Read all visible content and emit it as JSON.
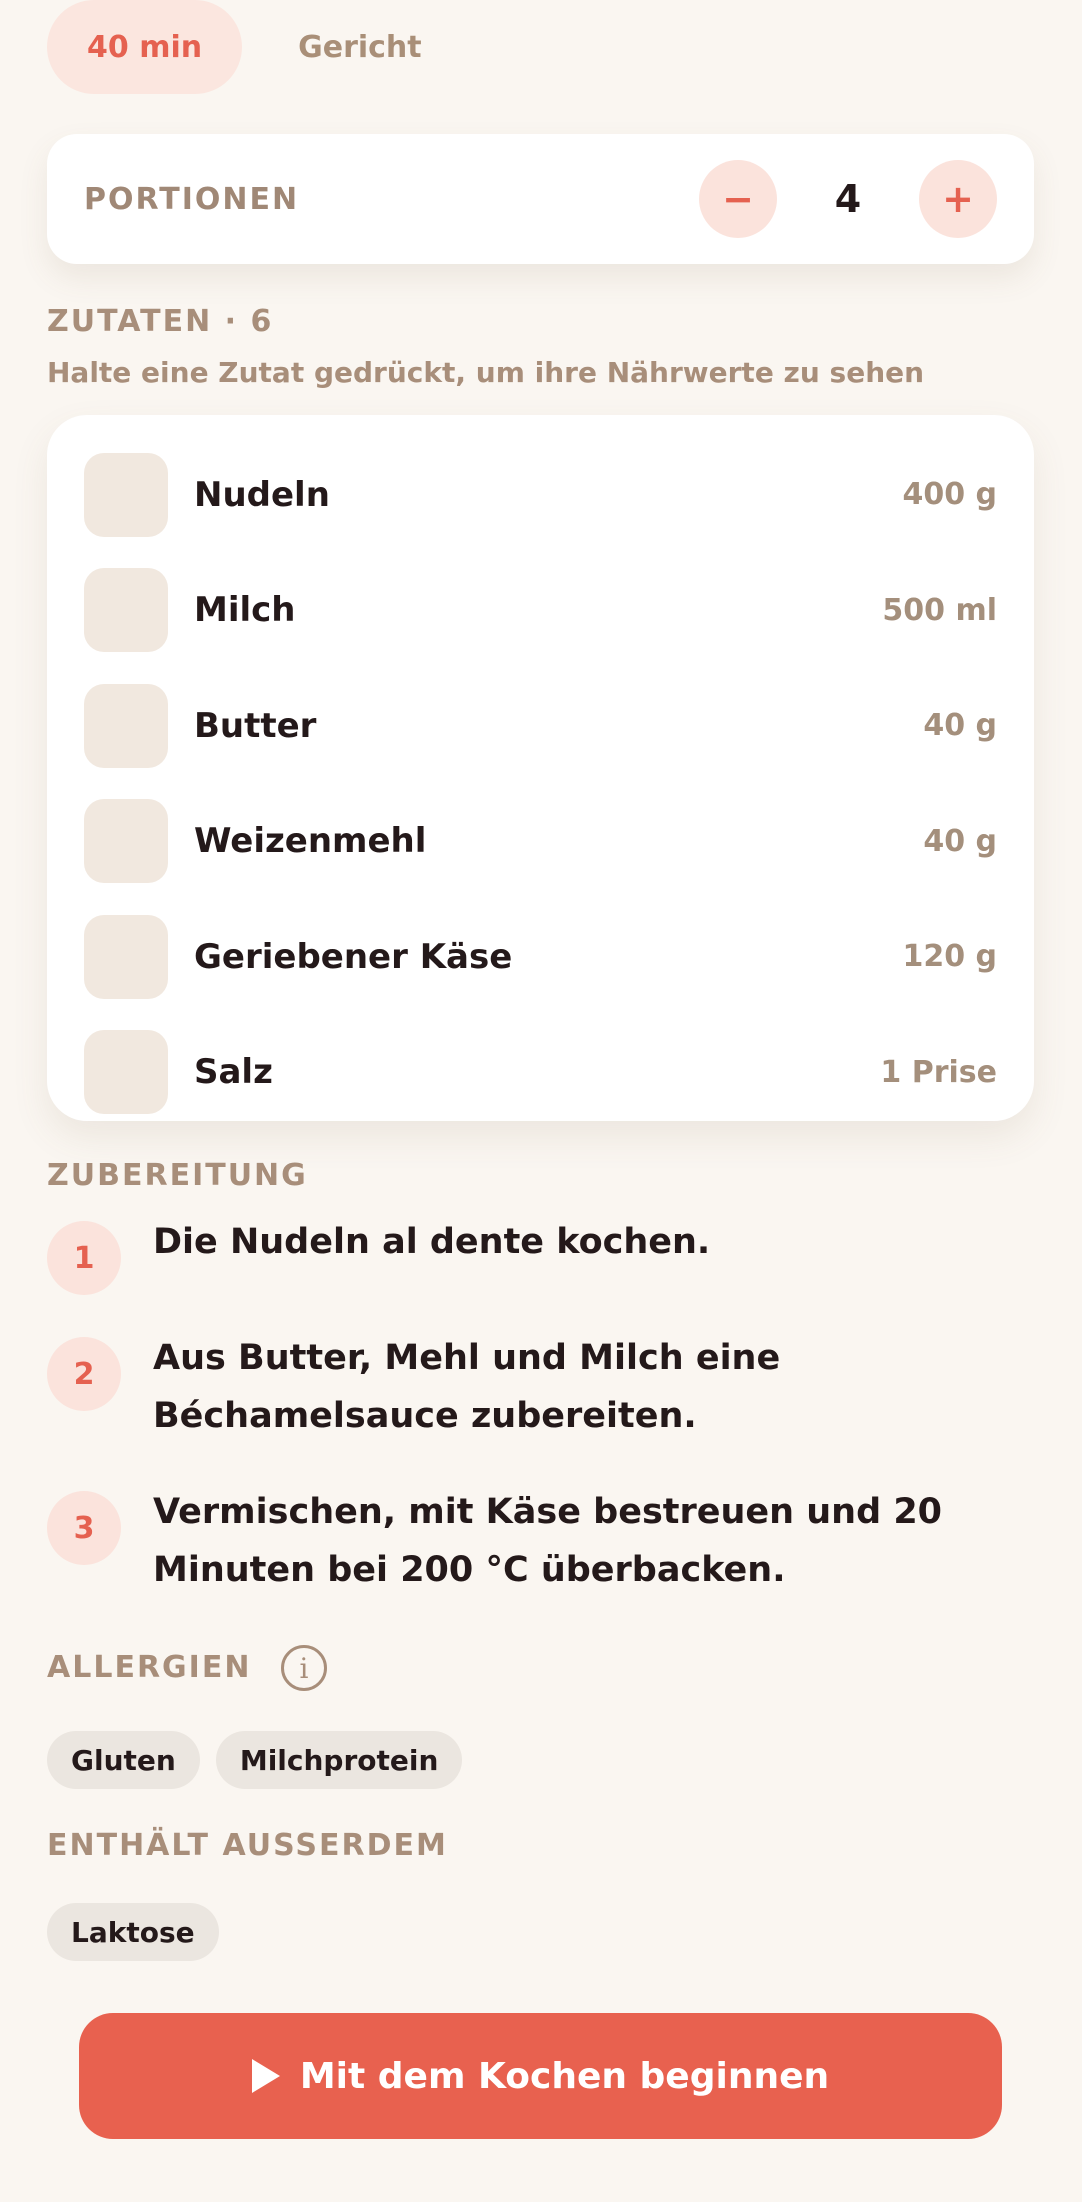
{
  "header": {
    "time_chip": "40 min",
    "type_label": "Gericht"
  },
  "portions": {
    "label": "PORTIONEN",
    "value": "4",
    "decrement_label": "−",
    "increment_label": "+"
  },
  "ingredients": {
    "title": "ZUTATEN · 6",
    "hint": "Halte eine Zutat gedrückt, um ihre Nährwerte zu sehen",
    "items": [
      {
        "name": "Nudeln",
        "qty": "400 g"
      },
      {
        "name": "Milch",
        "qty": "500 ml"
      },
      {
        "name": "Butter",
        "qty": "40 g"
      },
      {
        "name": "Weizenmehl",
        "qty": "40 g"
      },
      {
        "name": "Geriebener Käse",
        "qty": "120 g"
      },
      {
        "name": "Salz",
        "qty": "1 Prise"
      }
    ]
  },
  "preparation": {
    "title": "ZUBEREITUNG",
    "steps": [
      {
        "num": "1",
        "text": "Die Nudeln al dente kochen."
      },
      {
        "num": "2",
        "text": "Aus Butter, Mehl und Milch eine Béchamelsauce zubereiten."
      },
      {
        "num": "3",
        "text": "Vermischen, mit Käse bestreuen und 20 Minuten bei 200 °C überbacken."
      }
    ]
  },
  "allergens": {
    "title": "ALLERGIEN",
    "info_icon": "i",
    "items": [
      "Gluten",
      "Milchprotein"
    ]
  },
  "also_contains": {
    "title": "ENTHÄLT AUSSERDEM",
    "items": [
      "Laktose"
    ]
  },
  "cta": {
    "label": "Mit dem Kochen beginnen"
  },
  "colors": {
    "accent": "#E8614F",
    "background": "#FAF6F1",
    "muted_text": "#A88E7A"
  }
}
